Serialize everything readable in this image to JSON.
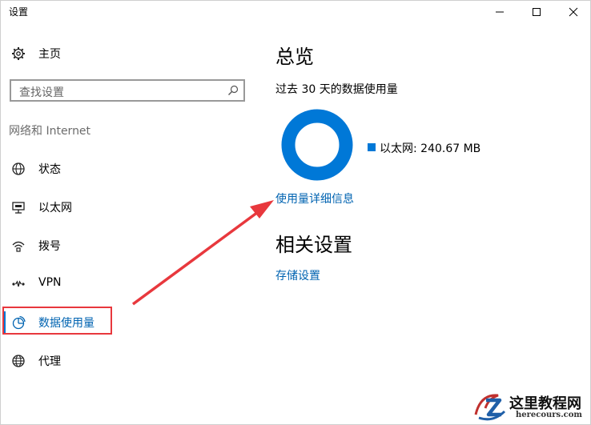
{
  "window": {
    "title": "设置"
  },
  "sidebar": {
    "home_label": "主页",
    "search_placeholder": "查找设置",
    "section_label": "网络和 Internet",
    "items": [
      {
        "label": "状态",
        "icon": "globe-status-icon"
      },
      {
        "label": "以太网",
        "icon": "ethernet-icon"
      },
      {
        "label": "拨号",
        "icon": "dialup-icon"
      },
      {
        "label": "VPN",
        "icon": "vpn-icon"
      },
      {
        "label": "数据使用量",
        "icon": "pie-chart-icon",
        "active": true
      },
      {
        "label": "代理",
        "icon": "globe-icon"
      }
    ]
  },
  "main": {
    "overview_title": "总览",
    "period_text": "过去 30 天的数据使用量",
    "legend_text": "以太网: 240.67 MB",
    "details_link": "使用量详细信息",
    "related_title": "相关设置",
    "storage_link": "存储设置"
  },
  "chart_data": {
    "type": "pie",
    "categories": [
      "以太网"
    ],
    "values": [
      240.67
    ],
    "unit": "MB"
  },
  "watermark": {
    "title": "这里教程网",
    "url": "herecours.com"
  },
  "colors": {
    "accent": "#0078d7",
    "link": "#0063b1",
    "annotation_red": "#e8383d"
  }
}
